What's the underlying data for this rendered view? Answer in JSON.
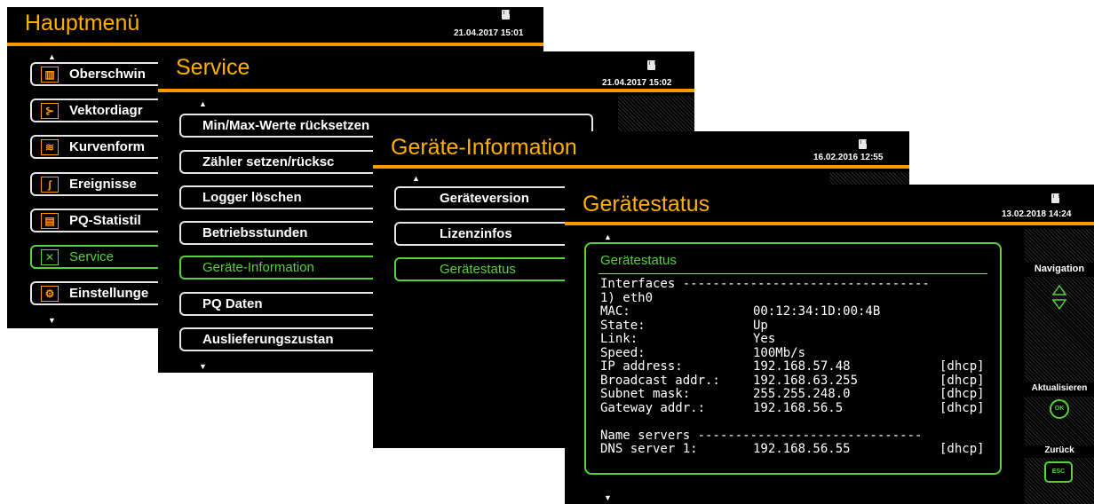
{
  "screen1": {
    "title": "Hauptmenü",
    "datetime": "21.04.2017 15:01",
    "items": [
      {
        "label": "Oberschwin",
        "icon": "harmonics-icon",
        "glyph": "▥"
      },
      {
        "label": "Vektordiagr",
        "icon": "vector-diagram-icon",
        "glyph": "⊱"
      },
      {
        "label": "Kurvenform",
        "icon": "waveform-icon",
        "glyph": "≋"
      },
      {
        "label": "Ereignisse",
        "icon": "events-icon",
        "glyph": "∫"
      },
      {
        "label": "PQ-Statistil",
        "icon": "pq-statistics-icon",
        "glyph": "▤"
      },
      {
        "label": "Service",
        "icon": "service-tools-icon",
        "glyph": "✕"
      },
      {
        "label": "Einstellunge",
        "icon": "settings-icon",
        "glyph": "⚙"
      }
    ]
  },
  "screen2": {
    "title": "Service",
    "datetime": "21.04.2017 15:02",
    "items": [
      {
        "label": "Min/Max-Werte rücksetzen"
      },
      {
        "label": "Zähler setzen/rücksc"
      },
      {
        "label": "Logger löschen"
      },
      {
        "label": "Betriebsstunden"
      },
      {
        "label": "Geräte-Information"
      },
      {
        "label": "PQ Daten"
      },
      {
        "label": "Auslieferungszustan"
      }
    ]
  },
  "screen3": {
    "title": "Geräte-Information",
    "datetime": "16.02.2016 12:55",
    "items": [
      {
        "label": "Geräteversion"
      },
      {
        "label": "Lizenzinfos"
      },
      {
        "label": "Gerätestatus"
      }
    ]
  },
  "screen4": {
    "title": "Gerätestatus",
    "datetime": "13.02.2018 14:24",
    "box_heading": "Gerätestatus",
    "lines": [
      {
        "label": "Interfaces ---------------------------------",
        "value": "",
        "tag": ""
      },
      {
        "label": "1) eth0",
        "value": "",
        "tag": ""
      },
      {
        "label": "MAC:",
        "value": "00:12:34:1D:00:4B",
        "tag": ""
      },
      {
        "label": "State:",
        "value": "Up",
        "tag": ""
      },
      {
        "label": "Link:",
        "value": "Yes",
        "tag": ""
      },
      {
        "label": "Speed:",
        "value": "100Mb/s",
        "tag": ""
      },
      {
        "label": "IP address:",
        "value": "192.168.57.48",
        "tag": "[dhcp]"
      },
      {
        "label": "Broadcast addr.:",
        "value": "192.168.63.255",
        "tag": "[dhcp]"
      },
      {
        "label": "Subnet mask:",
        "value": "255.255.248.0",
        "tag": "[dhcp]"
      },
      {
        "label": "Gateway addr.:",
        "value": "192.168.56.5",
        "tag": "[dhcp]"
      },
      {
        "label": "",
        "value": "",
        "tag": ""
      },
      {
        "label": "Name servers ------------------------------",
        "value": "",
        "tag": ""
      },
      {
        "label": "DNS server 1:",
        "value": "192.168.56.55",
        "tag": "[dhcp]"
      }
    ],
    "panel": {
      "navigation": "Navigation",
      "refresh": "Aktualisieren",
      "refresh_key": "OK",
      "back": "Zurück",
      "back_key": "ESC"
    }
  },
  "colors": {
    "accent": "#ff9900",
    "title": "#ffb000",
    "active": "#57d23a",
    "background": "#000000"
  }
}
